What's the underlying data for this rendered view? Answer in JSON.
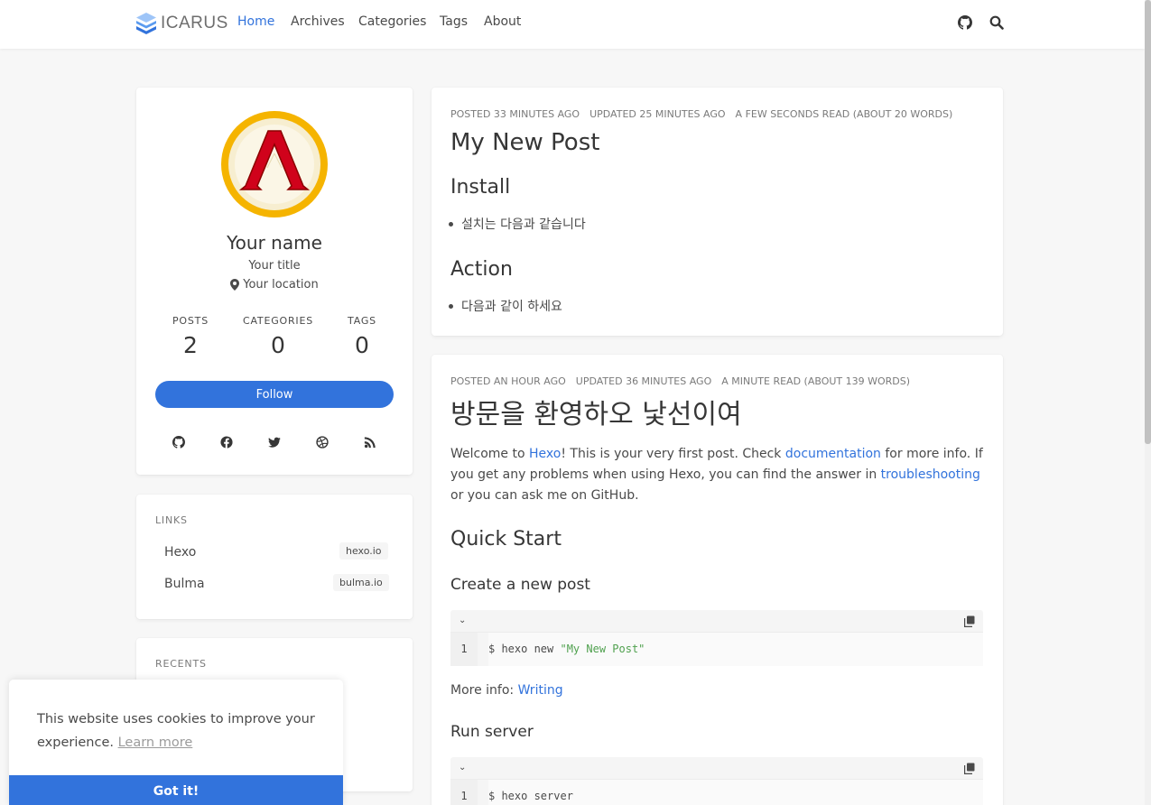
{
  "navbar": {
    "brand": "ICARUS",
    "items": [
      {
        "label": "Home"
      },
      {
        "label": "Archives"
      },
      {
        "label": "Categories"
      },
      {
        "label": "Tags"
      },
      {
        "label": "About"
      }
    ],
    "icons": [
      "github-icon",
      "search-icon"
    ]
  },
  "profile": {
    "name": "Your name",
    "title": "Your title",
    "location": "Your location",
    "stats": [
      {
        "label": "POSTS",
        "value": "2"
      },
      {
        "label": "CATEGORIES",
        "value": "0"
      },
      {
        "label": "TAGS",
        "value": "0"
      }
    ],
    "follow_label": "Follow",
    "social_icons": [
      "github-icon",
      "facebook-icon",
      "twitter-icon",
      "dribbble-icon",
      "rss-icon"
    ]
  },
  "links": {
    "label": "LINKS",
    "items": [
      {
        "name": "Hexo",
        "tag": "hexo.io"
      },
      {
        "name": "Bulma",
        "tag": "bulma.io"
      }
    ]
  },
  "recents": {
    "label": "RECENTS"
  },
  "posts": [
    {
      "meta": {
        "posted": "POSTED 33 MINUTES AGO",
        "updated": "UPDATED 25 MINUTES AGO",
        "read": "A FEW SECONDS READ (ABOUT 20 WORDS)"
      },
      "title": "My New Post",
      "sections": [
        {
          "heading": "Install",
          "item": "설치는 다음과 같습니다"
        },
        {
          "heading": "Action",
          "item": "다음과 같이 하세요"
        }
      ]
    },
    {
      "meta": {
        "posted": "POSTED AN HOUR AGO",
        "updated": "UPDATED 36 MINUTES AGO",
        "read": "A MINUTE READ (ABOUT 139 WORDS)"
      },
      "title": "방문을 환영하오 낯선이여",
      "intro": {
        "t1": "Welcome to ",
        "link1": "Hexo",
        "t2": "! This is your very first post. Check ",
        "link2": "documentation",
        "t3": " for more info. If you get any problems when using Hexo, you can find the answer in ",
        "link3": "troubleshooting",
        "t4": " or you can ask me on GitHub."
      },
      "quick_start": "Quick Start",
      "create_heading": "Create a new post",
      "code1": {
        "line_no": "1",
        "prefix": "$ hexo new ",
        "string": "\"My New Post\""
      },
      "more_info_label": "More info: ",
      "more_info_link": "Writing",
      "run_heading": "Run server",
      "code2": {
        "line_no": "1",
        "code": "$ hexo server"
      }
    }
  ],
  "cookie": {
    "text": "This website uses cookies to improve your experience.",
    "learn_more": "Learn more",
    "button": "Got it!"
  },
  "colors": {
    "accent": "#3273dc",
    "background": "#f7f7f7",
    "logo_gold": "#f4b400",
    "logo_red": "#d0021b"
  }
}
